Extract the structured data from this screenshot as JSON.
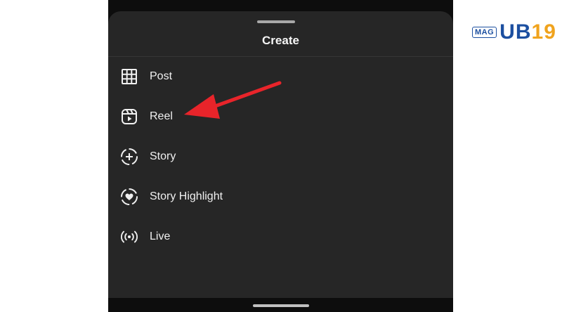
{
  "sheet": {
    "title": "Create",
    "items": [
      {
        "label": "Post",
        "icon": "grid-icon"
      },
      {
        "label": "Reel",
        "icon": "reel-icon"
      },
      {
        "label": "Story",
        "icon": "story-plus-icon"
      },
      {
        "label": "Story Highlight",
        "icon": "highlight-heart-icon"
      },
      {
        "label": "Live",
        "icon": "live-broadcast-icon"
      }
    ]
  },
  "annotation": {
    "color": "#e8242a",
    "points_to": "Reel"
  },
  "watermark": {
    "tag": "MAG",
    "brand_part1": "UB",
    "brand_part2": "19",
    "primary_color": "#1c4fa0",
    "accent_color": "#f0a31d"
  },
  "colors": {
    "sheet_bg": "#262626",
    "text": "#f0f0f0",
    "backdrop": "#0d0d0d"
  }
}
